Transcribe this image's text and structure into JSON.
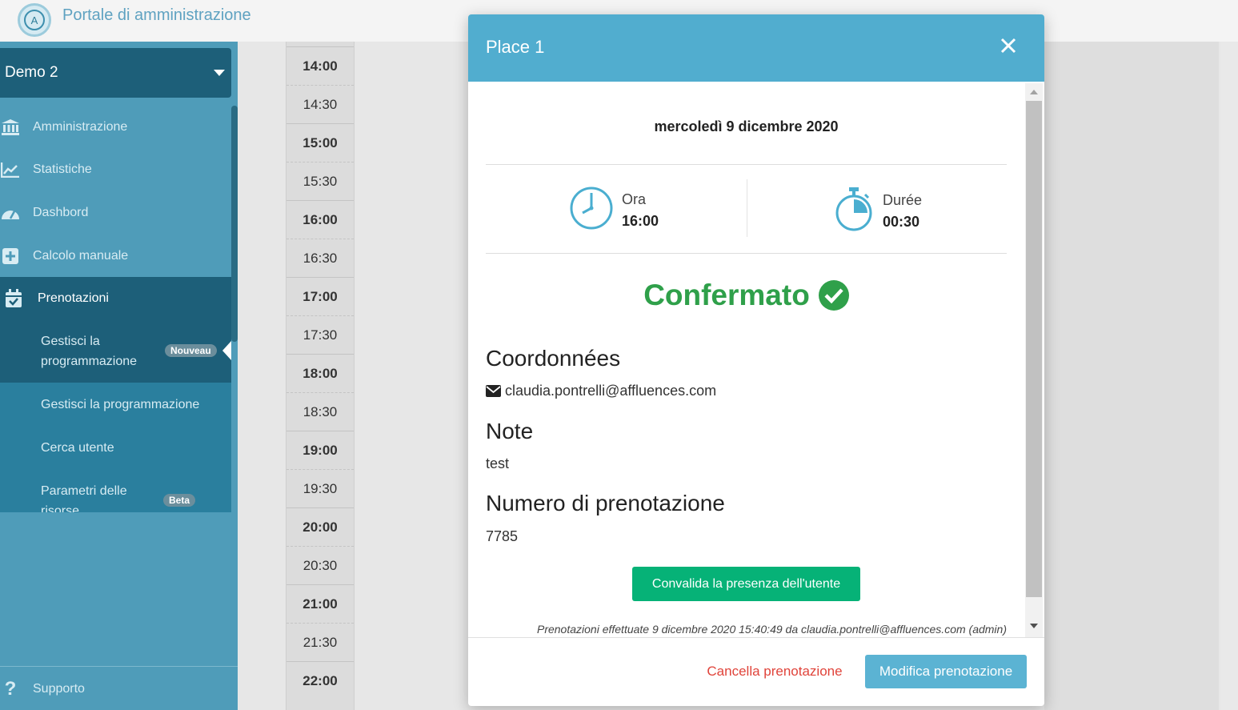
{
  "app": {
    "title": "Portale di amministrazione",
    "logo_letter": "A"
  },
  "sidebar": {
    "site_selector": "Demo 2",
    "items": [
      {
        "label": "Amministrazione"
      },
      {
        "label": "Statistiche"
      },
      {
        "label": "Dashbord"
      },
      {
        "label": "Calcolo manuale"
      },
      {
        "label": "Prenotazioni"
      }
    ],
    "sub_items": [
      {
        "label": "Gestisci la programmazione",
        "badge": "Nouveau"
      },
      {
        "label": "Gestisci la programmazione"
      },
      {
        "label": "Cerca utente"
      },
      {
        "label": "Parametri delle risorse",
        "badge": "Beta"
      }
    ],
    "support": "Supporto"
  },
  "timeline": {
    "slots": [
      "14:00",
      "14:30",
      "15:00",
      "15:30",
      "16:00",
      "16:30",
      "17:00",
      "17:30",
      "18:00",
      "18:30",
      "19:00",
      "19:30",
      "20:00",
      "20:30",
      "21:00",
      "21:30",
      "22:00"
    ]
  },
  "modal": {
    "title": "Place 1",
    "date": "mercoledì 9 dicembre 2020",
    "time_label": "Ora",
    "time_value": "16:00",
    "duration_label": "Durée",
    "duration_value": "00:30",
    "status": "Confermato",
    "status_color": "#2fa04a",
    "contact_title": "Coordonnées",
    "email": "claudia.pontrelli@affluences.com",
    "note_title": "Note",
    "note_text": "test",
    "number_title": "Numero di prenotazione",
    "number_value": "7785",
    "validate_button": "Convalida la presenza dell'utente",
    "footnote": "Prenotazioni effettuate 9 dicembre 2020 15:40:49 da claudia.pontrelli@affluences.com (admin)",
    "cancel_button": "Cancella prenotazione",
    "modify_button": "Modifica prenotazione"
  }
}
